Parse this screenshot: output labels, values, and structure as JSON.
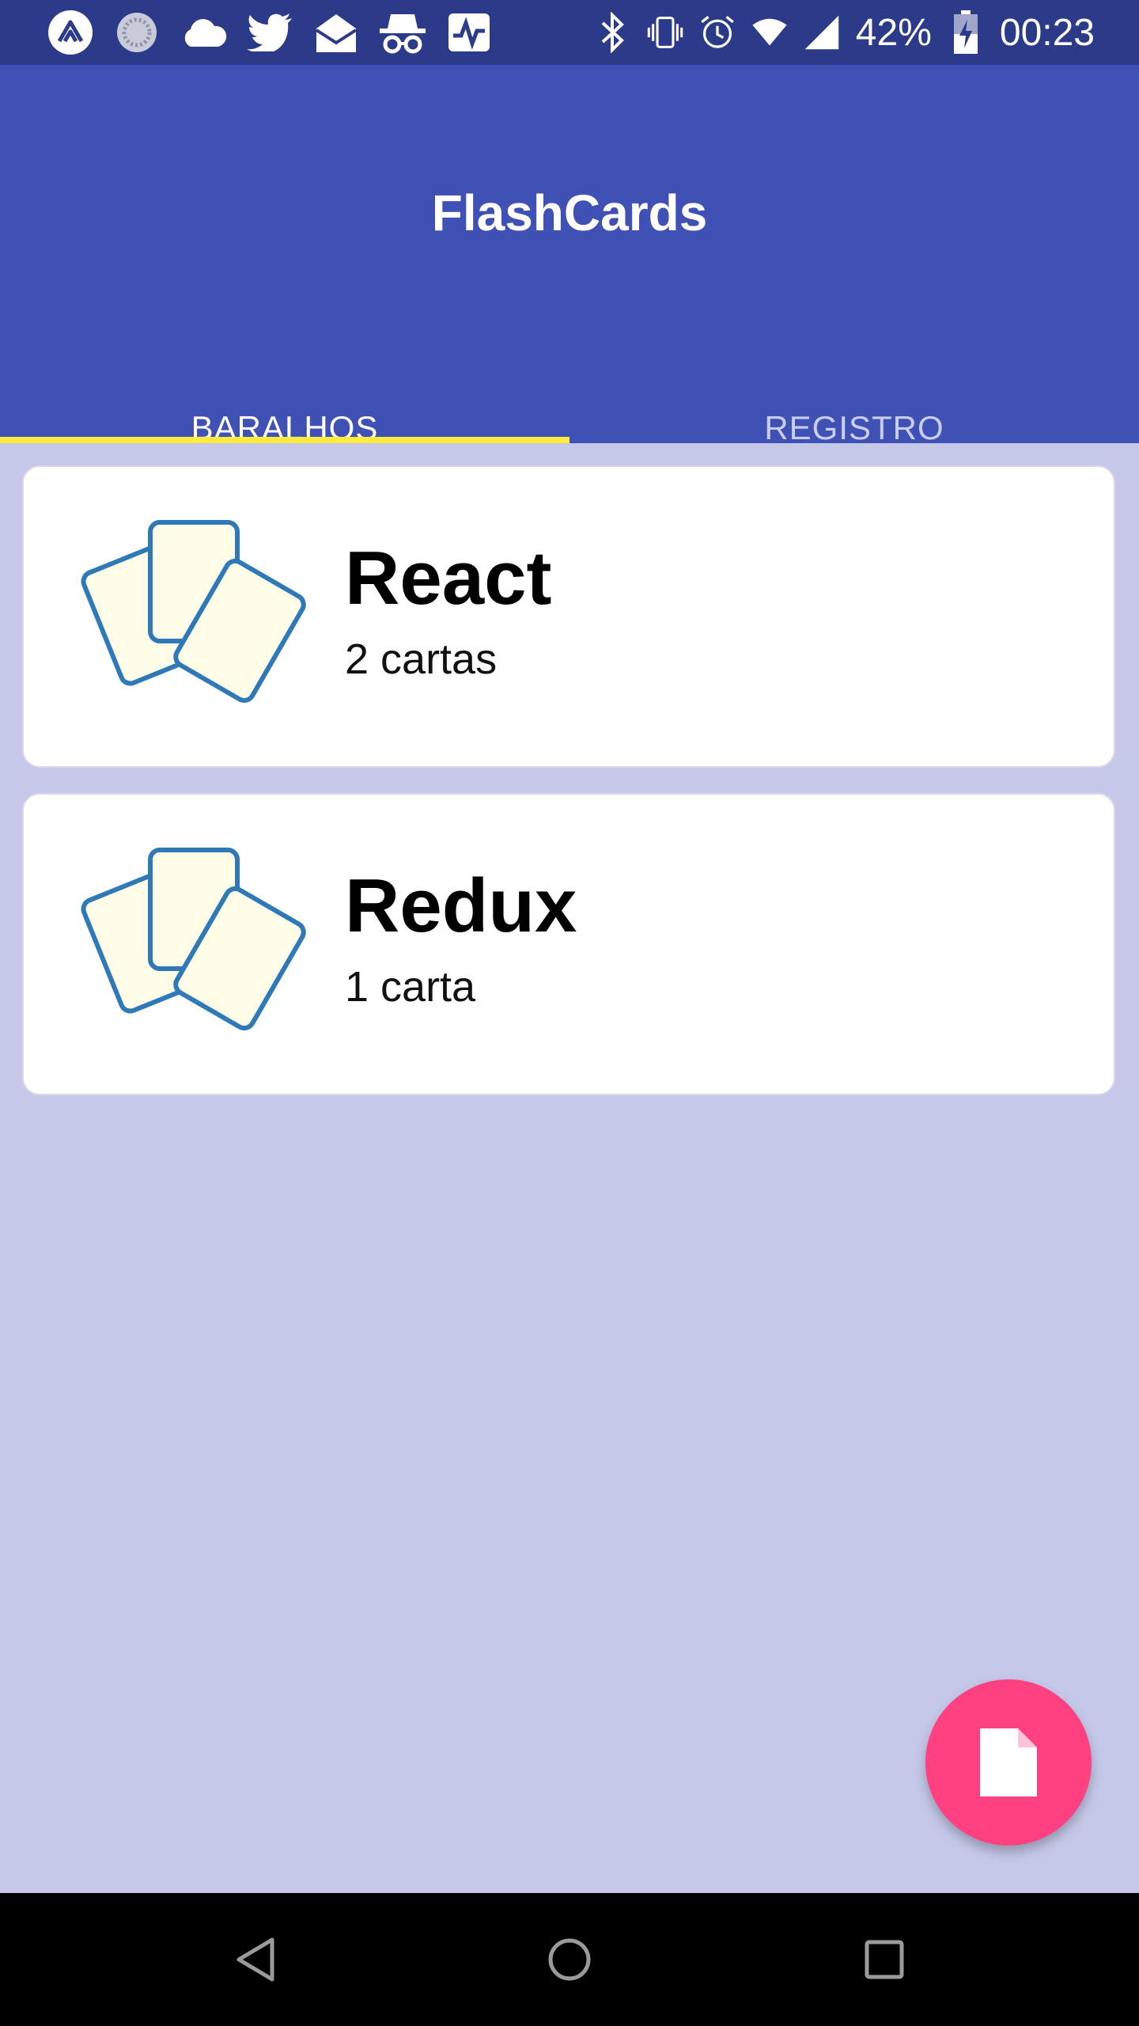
{
  "status_bar": {
    "battery": "42%",
    "time": "00:23",
    "left_icons": [
      "expo-icon",
      "sync-icon",
      "cloud-icon",
      "twitter-icon",
      "mail-icon",
      "incognito-icon",
      "activity-icon"
    ],
    "right_icons": [
      "bluetooth-icon",
      "vibrate-icon",
      "alarm-icon",
      "wifi-icon",
      "signal-icon",
      "battery-charging-icon"
    ]
  },
  "app": {
    "title": "FlashCards"
  },
  "tabs": [
    {
      "label": "BARALHOS",
      "active": true
    },
    {
      "label": "REGISTRO",
      "active": false
    }
  ],
  "decks": [
    {
      "title": "React",
      "count": "2 cartas",
      "icon": "cards-icon"
    },
    {
      "title": "Redux",
      "count": "1 carta",
      "icon": "cards-icon"
    }
  ],
  "fab": {
    "icon": "new-file-icon"
  },
  "nav_bar": {
    "icons": [
      "back-icon",
      "home-icon",
      "recents-icon"
    ]
  },
  "colors": {
    "status_bar": "#2c3a8a",
    "app_bar": "#3f51b5",
    "tab_indicator": "#ffeb3b",
    "background": "#c5c8e8",
    "fab": "#ff4081",
    "card_fill": "#fffde7",
    "card_stroke": "#2e7ab8"
  }
}
